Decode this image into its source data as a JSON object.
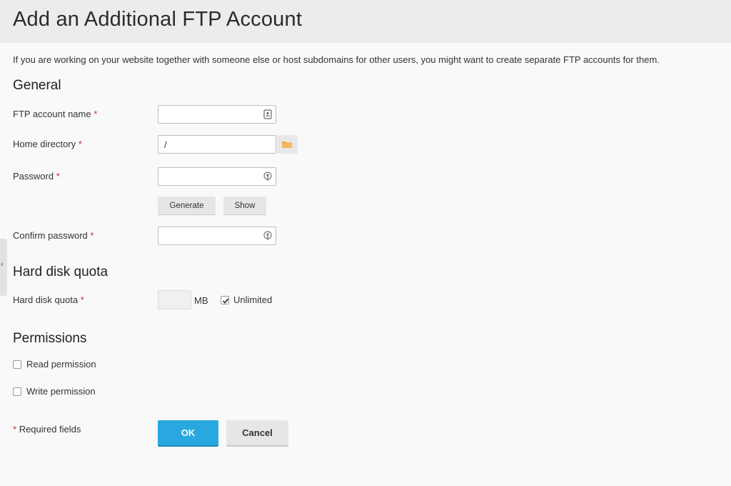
{
  "header": {
    "title": "Add an Additional FTP Account"
  },
  "intro_text": "If you are working on your website together with someone else or host subdomains for other users, you might want to create separate FTP accounts for them.",
  "general": {
    "title": "General",
    "ftp_account_name": {
      "label": "FTP account name",
      "value": ""
    },
    "home_directory": {
      "label": "Home directory",
      "value": "/"
    },
    "password": {
      "label": "Password",
      "value": ""
    },
    "generate_label": "Generate",
    "show_label": "Show",
    "confirm_password": {
      "label": "Confirm password",
      "value": ""
    }
  },
  "quota": {
    "title": "Hard disk quota",
    "label": "Hard disk quota",
    "value": "",
    "unit": "MB",
    "unlimited_label": "Unlimited",
    "unlimited_checked": true
  },
  "permissions": {
    "title": "Permissions",
    "read_label": "Read permission",
    "read_checked": false,
    "write_label": "Write permission",
    "write_checked": false
  },
  "required_asterisk": "*",
  "required_text": "Required fields",
  "ok_label": "OK",
  "cancel_label": "Cancel",
  "side_tab_glyph": "‹",
  "colors": {
    "accent": "#29a8e0",
    "required": "#d02b2b",
    "folder": "#f0a64a"
  },
  "icons": {
    "ftp_name_field": "contact-card-icon",
    "home_dir_button": "folder-icon",
    "password_field": "key-lock-icon",
    "confirm_field": "key-lock-icon",
    "side_tab": "chevron-left-icon"
  }
}
